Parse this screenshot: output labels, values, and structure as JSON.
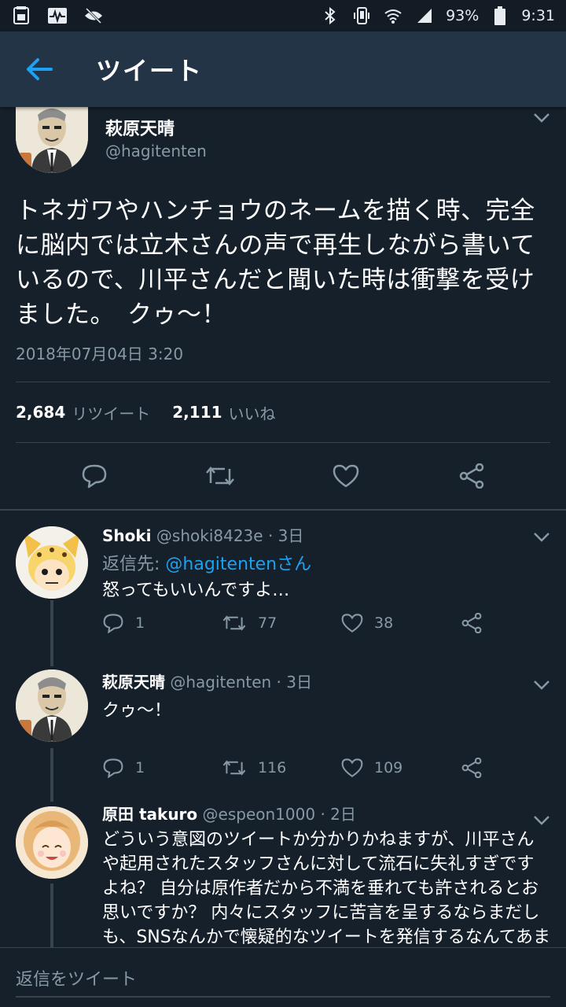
{
  "status_bar": {
    "battery": "93%",
    "time": "9:31",
    "icons": [
      "sim-icon",
      "pulse-icon",
      "eye-off-icon",
      "bluetooth-icon",
      "vibrate-icon",
      "wifi-icon",
      "signal-icon",
      "battery-icon"
    ]
  },
  "app_bar": {
    "title": "ツイート",
    "back_icon": "arrow-left-icon"
  },
  "main_tweet": {
    "name": "萩原天晴",
    "handle": "@hagitenten",
    "text": "トネガワやハンチョウのネームを描く時、完全に脳内では立木さんの声で再生しながら書いているので、川平さんだと聞いた時は衝撃を受けました。　クゥ～！",
    "date": "2018年07月04日 3:20",
    "retweet_count": "2,684",
    "retweet_label": "リツイート",
    "like_count": "2,111",
    "like_label": "いいね"
  },
  "replies": [
    {
      "name": "Shoki",
      "handle": "@shoki8423e",
      "time": "· 3日",
      "reply_to_label": "返信先: ",
      "reply_to_handle": "@hagitentenさん",
      "text": "怒ってもいいんですよ…",
      "reply_count": "1",
      "retweet_count": "77",
      "like_count": "38"
    },
    {
      "name": "萩原天晴",
      "handle": "@hagitenten",
      "time": "· 3日",
      "text": "クゥ～！",
      "reply_count": "1",
      "retweet_count": "116",
      "like_count": "109"
    },
    {
      "name": "原田 takuro",
      "handle": "@espeon1000",
      "time": "· 2日",
      "text": "どういう意図のツイートか分かりかねますが、川平さんや起用されたスタッフさんに対して流石に失礼すぎですよね？ 自分は原作者だから不満を垂れても許されるとお思いですか？ 内々にスタッフに苦言を呈するならまだしも、SNSなんかで懐疑的なツイートを発信するなんてあまりに軽率かと"
    }
  ],
  "reply_bar": {
    "placeholder": "返信をツイート"
  },
  "colors": {
    "background": "#15202b",
    "app_bar": "#243447",
    "accent": "#1da1f2",
    "secondary_text": "#8899a6",
    "divider": "#38444d"
  }
}
